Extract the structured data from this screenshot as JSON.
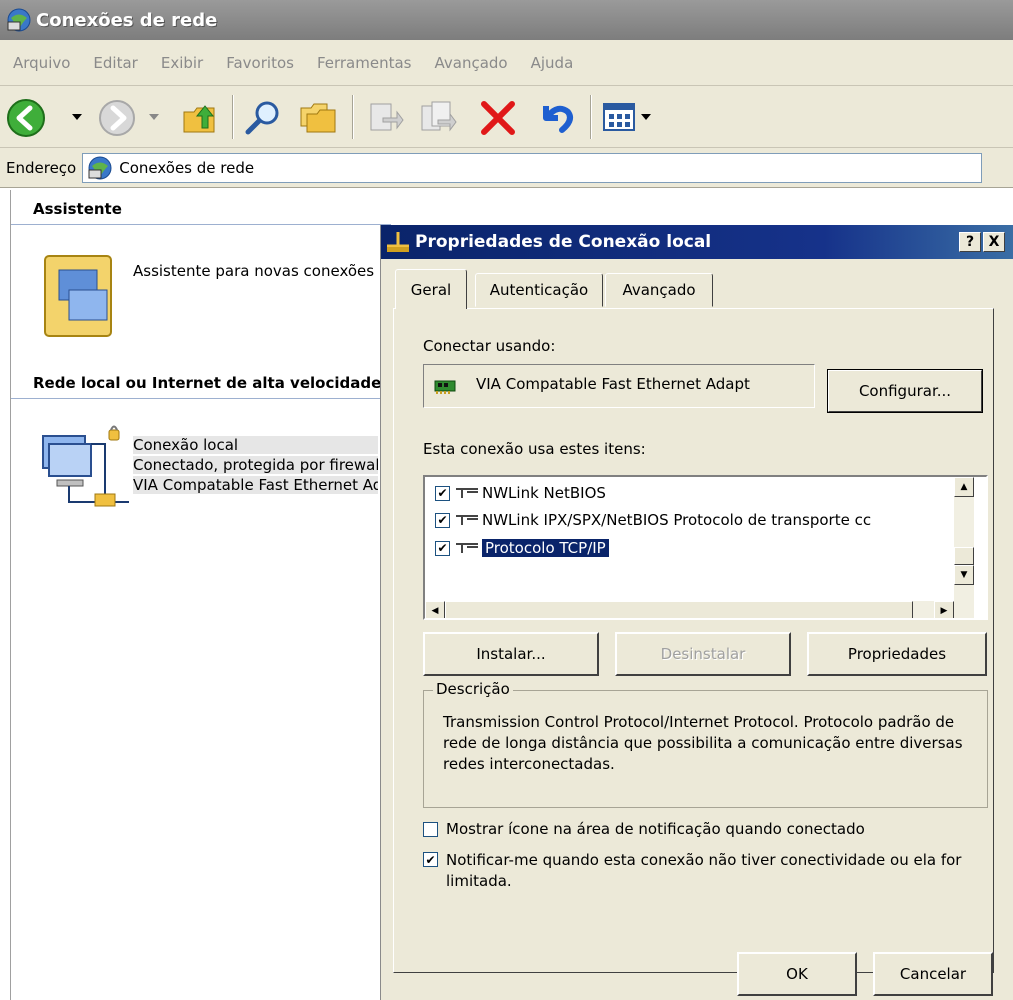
{
  "window": {
    "title": "Conexões de rede",
    "menu": [
      "Arquivo",
      "Editar",
      "Exibir",
      "Favoritos",
      "Ferramentas",
      "Avançado",
      "Ajuda"
    ],
    "address_label": "Endereço",
    "address_value": "Conexões de rede"
  },
  "content": {
    "section_wizard": "Assistente",
    "wizard_item": "Assistente para novas conexões",
    "section_lan": "Rede local ou Internet de alta velocidade",
    "connection": {
      "name": "Conexão local",
      "status": "Conectado, protegida por firewall",
      "device": "VIA Compatable Fast Ethernet Adapter"
    }
  },
  "dialog": {
    "title": "Propriedades de Conexão local",
    "help_button": "?",
    "close_button": "X",
    "tabs": [
      "Geral",
      "Autenticação",
      "Avançado"
    ],
    "active_tab": "Geral",
    "connect_using_label": "Conectar usando:",
    "adapter_name": "VIA Compatable Fast Ethernet Adapt",
    "configure_button": "Configurar...",
    "items_label": "Esta conexão usa estes itens:",
    "items": [
      {
        "label": "NWLink NetBIOS",
        "checked": true,
        "selected": false
      },
      {
        "label": "NWLink IPX/SPX/NetBIOS Protocolo de transporte cc",
        "checked": true,
        "selected": false
      },
      {
        "label": "Protocolo TCP/IP",
        "checked": true,
        "selected": true
      }
    ],
    "install_button": "Instalar...",
    "uninstall_button": "Desinstalar",
    "properties_button": "Propriedades",
    "description_label": "Descrição",
    "description_text": "Transmission Control Protocol/Internet Protocol. Protocolo padrão de rede de longa distância que possibilita a comunicação entre diversas redes interconectadas.",
    "show_icon_option": {
      "label": "Mostrar ícone na área de notificação quando conectado",
      "checked": false
    },
    "notify_option": {
      "label": "Notificar-me quando esta conexão não tiver conectividade ou ela for limitada.",
      "checked": true
    },
    "ok_button": "OK",
    "cancel_button": "Cancelar",
    "check_mark": "✔"
  },
  "colors": {
    "dialog_title_bg": "#0a246a",
    "selection": "#0a246a",
    "face": "#ece9d8"
  }
}
